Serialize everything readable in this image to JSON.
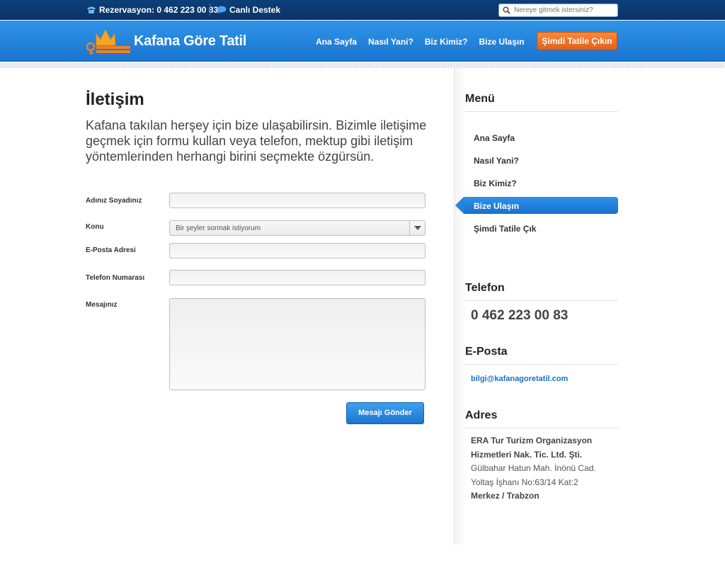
{
  "topbar": {
    "reservation_label": "Rezervasyon: 0 462 223 00 83",
    "support_label": "Canlı Destek",
    "search_placeholder": "Nereye gitmek istersiniz?"
  },
  "header": {
    "brand": "Kafana Göre Tatil",
    "nav": [
      "Ana Sayfa",
      "Nasıl Yani?",
      "Biz Kimiz?",
      "Bize Ulaşın"
    ],
    "cta": "Şimdi Tatile Çıkın"
  },
  "main": {
    "title": "İletişim",
    "intro": "Kafana takılan herşey için bize ulaşabilirsin. Bizimle iletişime geçmek için formu kullan veya telefon, mektup gibi iletişim yöntemlerinden herhangi birini seçmekte özgürsün.",
    "form": {
      "name_label": "Adınız Soyadınız",
      "subject_label": "Konu",
      "subject_value": "Bir şeyler sormak istiyorum",
      "email_label": "E-Posta Adresi",
      "phone_label": "Telefon Numarası",
      "message_label": "Mesajınız",
      "submit": "Mesajı Gönder"
    }
  },
  "sidebar": {
    "menu_title": "Menü",
    "menu_items": [
      "Ana Sayfa",
      "Nasıl Yani?",
      "Biz Kimiz?",
      "Bize Ulaşın",
      "Şimdi Tatile Çık"
    ],
    "phone_title": "Telefon",
    "phone": "0 462 223 00 83",
    "email_title": "E-Posta",
    "email": "bilgi@kafanagoretatil.com",
    "address_title": "Adres",
    "address_lines": [
      "ERA Tur Turizm Organizasyon",
      "Hizmetleri Nak. Tic. Ltd. Şti.",
      "Gülbahar Hatun Mah. İnönü Cad.",
      "Yoltaş İşhanı No:63/14 Kat:2",
      "Merkez / Trabzon"
    ]
  },
  "colors": {
    "brand_blue": "#1a74cf",
    "cta_orange": "#f07a2c",
    "link_blue": "#1b6fc6"
  },
  "icons": [
    "phone-icon",
    "chat-bubble-icon",
    "search-icon",
    "crown-logo-icon",
    "dropdown-arrow-icon"
  ]
}
